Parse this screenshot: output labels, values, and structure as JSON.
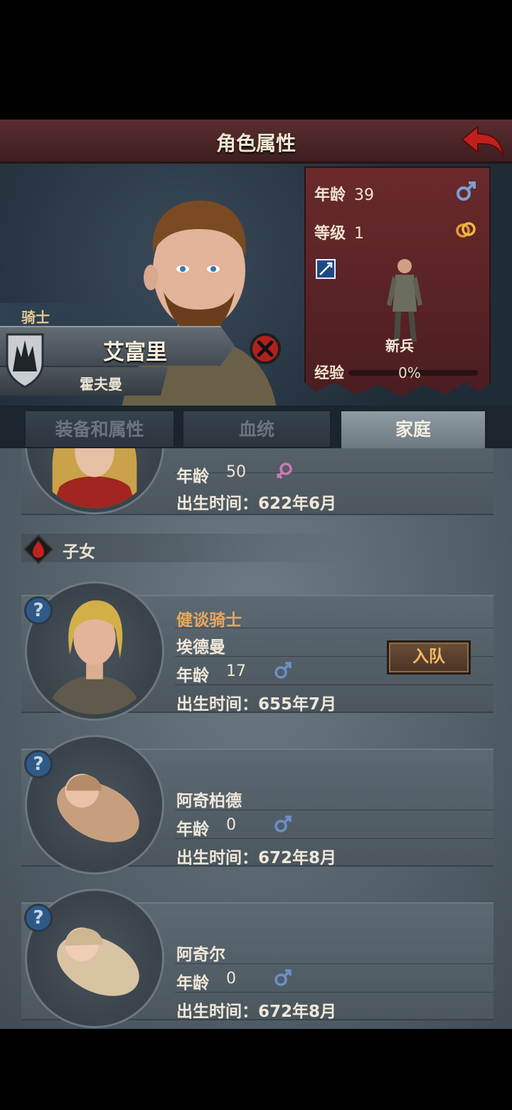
{
  "header": {
    "title": "角色属性"
  },
  "hero": {
    "class_label": "骑士",
    "first_name": "艾富里",
    "surname": "霍夫曼"
  },
  "stats": {
    "age_label": "年龄",
    "age_value": "39",
    "level_label": "等级",
    "level_value": "1",
    "unit_label": "新兵",
    "exp_label": "经验",
    "exp_percent": "0%",
    "exp_fraction": 0
  },
  "tabs": [
    {
      "label": "装备和属性",
      "active": false
    },
    {
      "label": "血统",
      "active": false
    },
    {
      "label": "家庭",
      "active": true
    }
  ],
  "spouse": {
    "age_label": "年龄",
    "age_value": "50",
    "gender": "female",
    "birth": "出生时间：622年6月"
  },
  "children_section": {
    "label": "子女"
  },
  "children": [
    {
      "title": "健谈骑士",
      "name": "埃德曼",
      "age_label": "年龄",
      "age_value": "17",
      "gender": "male",
      "birth": "出生时间：655年7月",
      "button": "入队"
    },
    {
      "name": "阿奇柏德",
      "age_label": "年龄",
      "age_value": "0",
      "gender": "male",
      "birth": "出生时间：672年8月"
    },
    {
      "name": "阿奇尔",
      "age_label": "年龄",
      "age_value": "0",
      "gender": "male",
      "birth": "出生时间：672年8月"
    }
  ],
  "colors": {
    "accent_orange": "#e7a660",
    "male": "#6b8fc9",
    "female": "#c97ab8",
    "header_red": "#5a2e30"
  }
}
